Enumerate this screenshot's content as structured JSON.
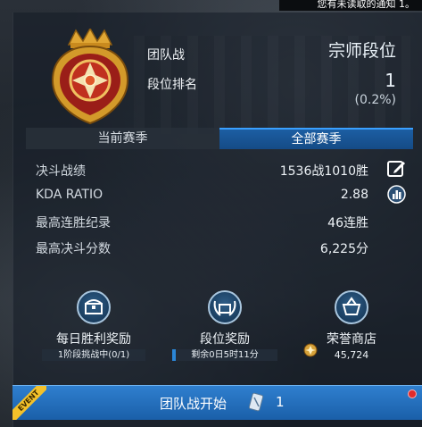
{
  "notification": "您有未读取的通知 1。",
  "header": {
    "mode_label": "团队战",
    "rank_name": "宗师段位",
    "rank_label": "段位排名",
    "rank_position": "1",
    "rank_percent": "(0.2%)"
  },
  "tabs": [
    {
      "label": "当前赛季",
      "active": false
    },
    {
      "label": "全部赛季",
      "active": true
    }
  ],
  "stats": [
    {
      "label": "决斗战绩",
      "value": "1536战1010胜",
      "icon": "edit-icon"
    },
    {
      "label": "KDA RATIO",
      "value": "2.88",
      "icon": "info-icon"
    },
    {
      "label": "最高连胜纪录",
      "value": "46连胜"
    },
    {
      "label": "最高决斗分数",
      "value": "6,225分"
    }
  ],
  "rewards": {
    "daily": {
      "title": "每日胜利奖励",
      "status": "1阶段挑战中(0/1)",
      "progress": 0,
      "icon": "chest-icon"
    },
    "rank": {
      "title": "段位奖励",
      "status": "剩余0日5时11分",
      "progress": 0.03,
      "icon": "laurel-chest-icon"
    },
    "shop": {
      "title": "荣誉商店",
      "points": "45,724",
      "icon": "basket-icon"
    }
  },
  "bottom": {
    "event_tag": "EVENT",
    "label": "团队战开始",
    "ticket_count": "1"
  },
  "colors": {
    "accent_blue": "#2f7fcf",
    "gold": "#e0a634",
    "badge_red": "#e12b2b"
  }
}
